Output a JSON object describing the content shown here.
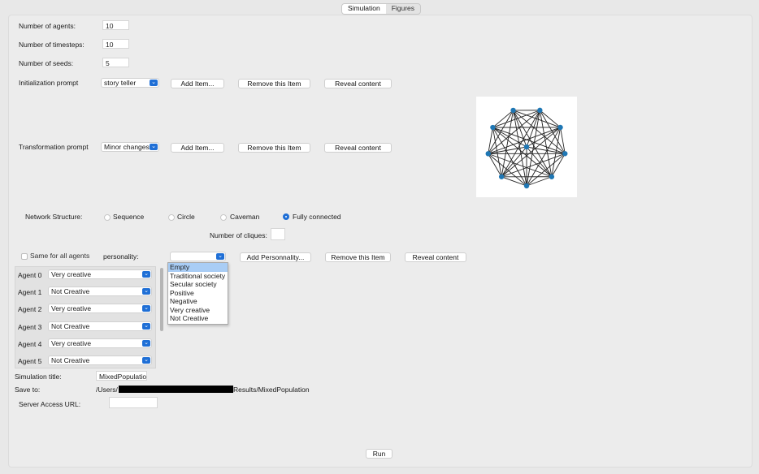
{
  "tabs": [
    {
      "label": "Simulation",
      "active": true
    },
    {
      "label": "Figures",
      "active": false
    }
  ],
  "form": {
    "num_agents_label": "Number of agents:",
    "num_agents_value": "10",
    "num_timesteps_label": "Number of timesteps:",
    "num_timesteps_value": "10",
    "num_seeds_label": "Number of seeds:",
    "num_seeds_value": "5",
    "init_prompt_label": "Initialization prompt",
    "init_prompt_value": "story teller",
    "transform_prompt_label": "Transformation prompt",
    "transform_prompt_value": "Minor changes",
    "add_item": "Add Item...",
    "remove_item": "Remove this Item",
    "reveal_content": "Reveal content"
  },
  "network": {
    "label": "Network Structure:",
    "options": [
      {
        "label": "Sequence",
        "checked": false
      },
      {
        "label": "Circle",
        "checked": false
      },
      {
        "label": "Caveman",
        "checked": false
      },
      {
        "label": "Fully connected",
        "checked": true
      }
    ],
    "cliques_label": "Number of cliques:",
    "cliques_value": ""
  },
  "personality": {
    "same_for_all_label": "Same for all agents",
    "label": "personality:",
    "value": "",
    "add_button": "Add Personnality...",
    "remove_button": "Remove this Item",
    "reveal_button": "Reveal content",
    "dropdown_options": [
      "Empty",
      "Traditional society",
      "Secular society",
      "Positive",
      "Negative",
      "Very creative",
      "Not Creative"
    ],
    "dropdown_selected": "Empty"
  },
  "agents": [
    {
      "label": "Agent 0",
      "value": "Very creative"
    },
    {
      "label": "Agent 1",
      "value": "Not Creative"
    },
    {
      "label": "Agent 2",
      "value": "Very creative"
    },
    {
      "label": "Agent 3",
      "value": "Not Creative"
    },
    {
      "label": "Agent 4",
      "value": "Very creative"
    },
    {
      "label": "Agent 5",
      "value": "Not Creative"
    }
  ],
  "simulation": {
    "title_label": "Simulation title:",
    "title_value": "MixedPopulatio",
    "save_label": "Save to:",
    "save_path_prefix": "/Users/",
    "save_path_suffix": "Results/MixedPopulation",
    "server_label": "Server Access URL:",
    "server_value": "",
    "run_button": "Run"
  },
  "graph": {
    "node_color": "#1f77b4",
    "edge_color": "#222222",
    "node_count": 10
  },
  "icons": {
    "chevron": "chevron-down-icon"
  }
}
